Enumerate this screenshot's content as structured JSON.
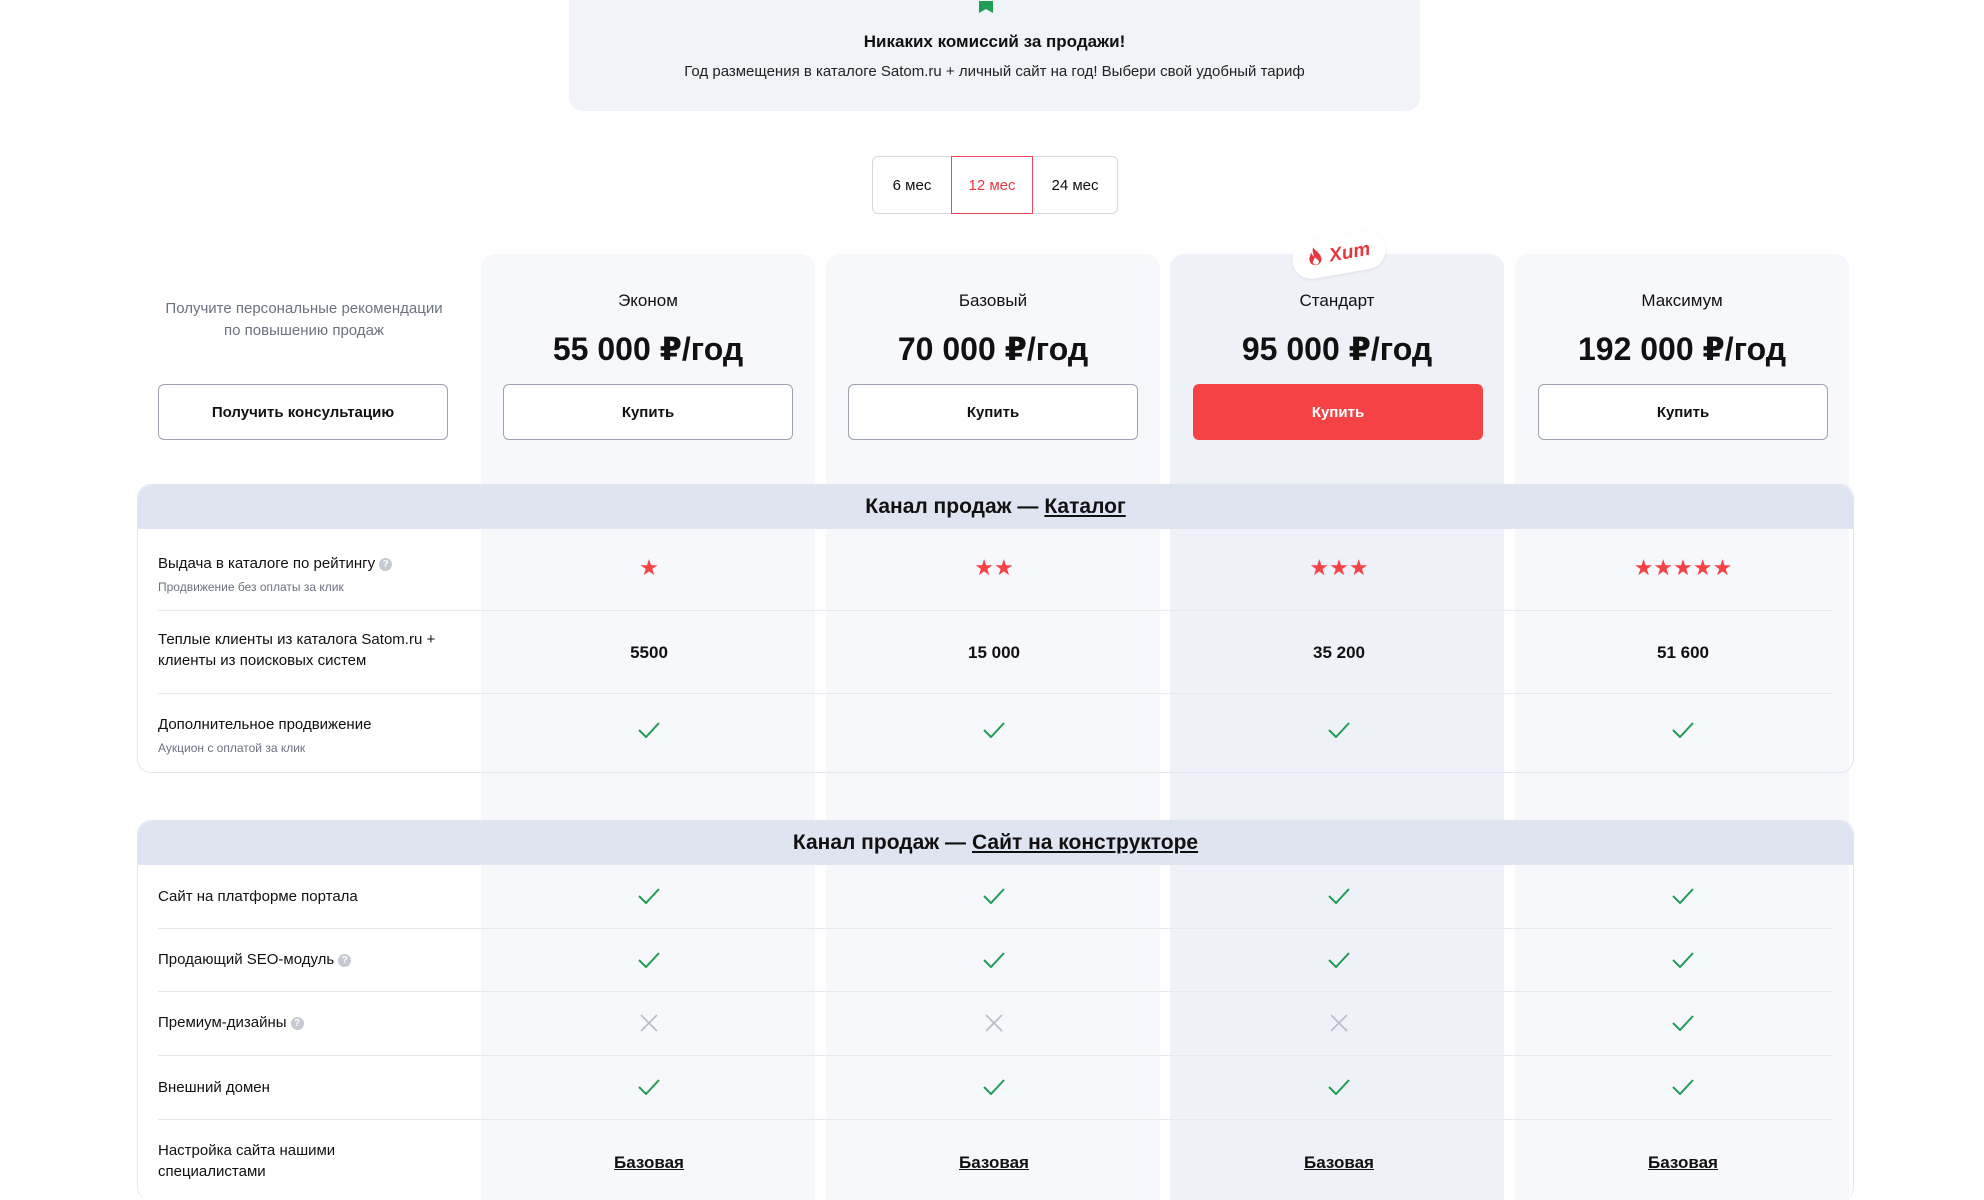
{
  "promo": {
    "title": "Никаких комиссий за продажи!",
    "subtitle": "Год размещения в каталоге Satom.ru + личный сайт на год! Выбери свой удобный тариф"
  },
  "period": {
    "options": [
      "6 мес",
      "12 мес",
      "24 мес"
    ],
    "selected": "12 мес"
  },
  "consult": {
    "text": "Получите персональные рекомендации по повышению продаж",
    "button": "Получить консультацию"
  },
  "hit_label": "Хит",
  "plans": [
    {
      "name": "Эконом",
      "price": "55 000 ₽/год",
      "button": "Купить"
    },
    {
      "name": "Базовый",
      "price": "70 000 ₽/год",
      "button": "Купить"
    },
    {
      "name": "Стандарт",
      "price": "95 000 ₽/год",
      "button": "Купить"
    },
    {
      "name": "Максимум",
      "price": "192 000 ₽/год",
      "button": "Купить"
    }
  ],
  "section1": {
    "prefix": "Канал продаж —",
    "link": "Каталог",
    "rows": [
      {
        "label": "Выдача в каталоге по рейтингу",
        "sub": "Продвижение без оплаты за клик",
        "stars": [
          1,
          2,
          3,
          5
        ]
      },
      {
        "label": "Теплые клиенты из каталога Satom.ru + клиенты из поисковых систем",
        "values": [
          "5500",
          "15 000",
          "35 200",
          "51 600"
        ]
      },
      {
        "label": "Дополнительное продвижение",
        "sub": "Аукцион с оплатой за клик",
        "checks": [
          true,
          true,
          true,
          true
        ]
      }
    ]
  },
  "section2": {
    "prefix": "Канал продаж —",
    "link": "Сайт на конструкторе",
    "rows": [
      {
        "label": "Сайт на платформе портала",
        "checks": [
          true,
          true,
          true,
          true
        ]
      },
      {
        "label": "Продающий SEO-модуль",
        "checks": [
          true,
          true,
          true,
          true
        ]
      },
      {
        "label": "Премиум-дизайны",
        "checks": [
          false,
          false,
          false,
          true
        ]
      },
      {
        "label": "Внешний домен",
        "checks": [
          true,
          true,
          true,
          true
        ]
      },
      {
        "label": "Настройка сайта нашими специалистами",
        "values": [
          "Базовая",
          "Базовая",
          "Базовая",
          "Базовая"
        ]
      }
    ]
  },
  "colors": {
    "accent": "#f54245",
    "check": "#1f9d55",
    "cross": "#b8bcc4",
    "header_bg": "#dfe4f1"
  }
}
